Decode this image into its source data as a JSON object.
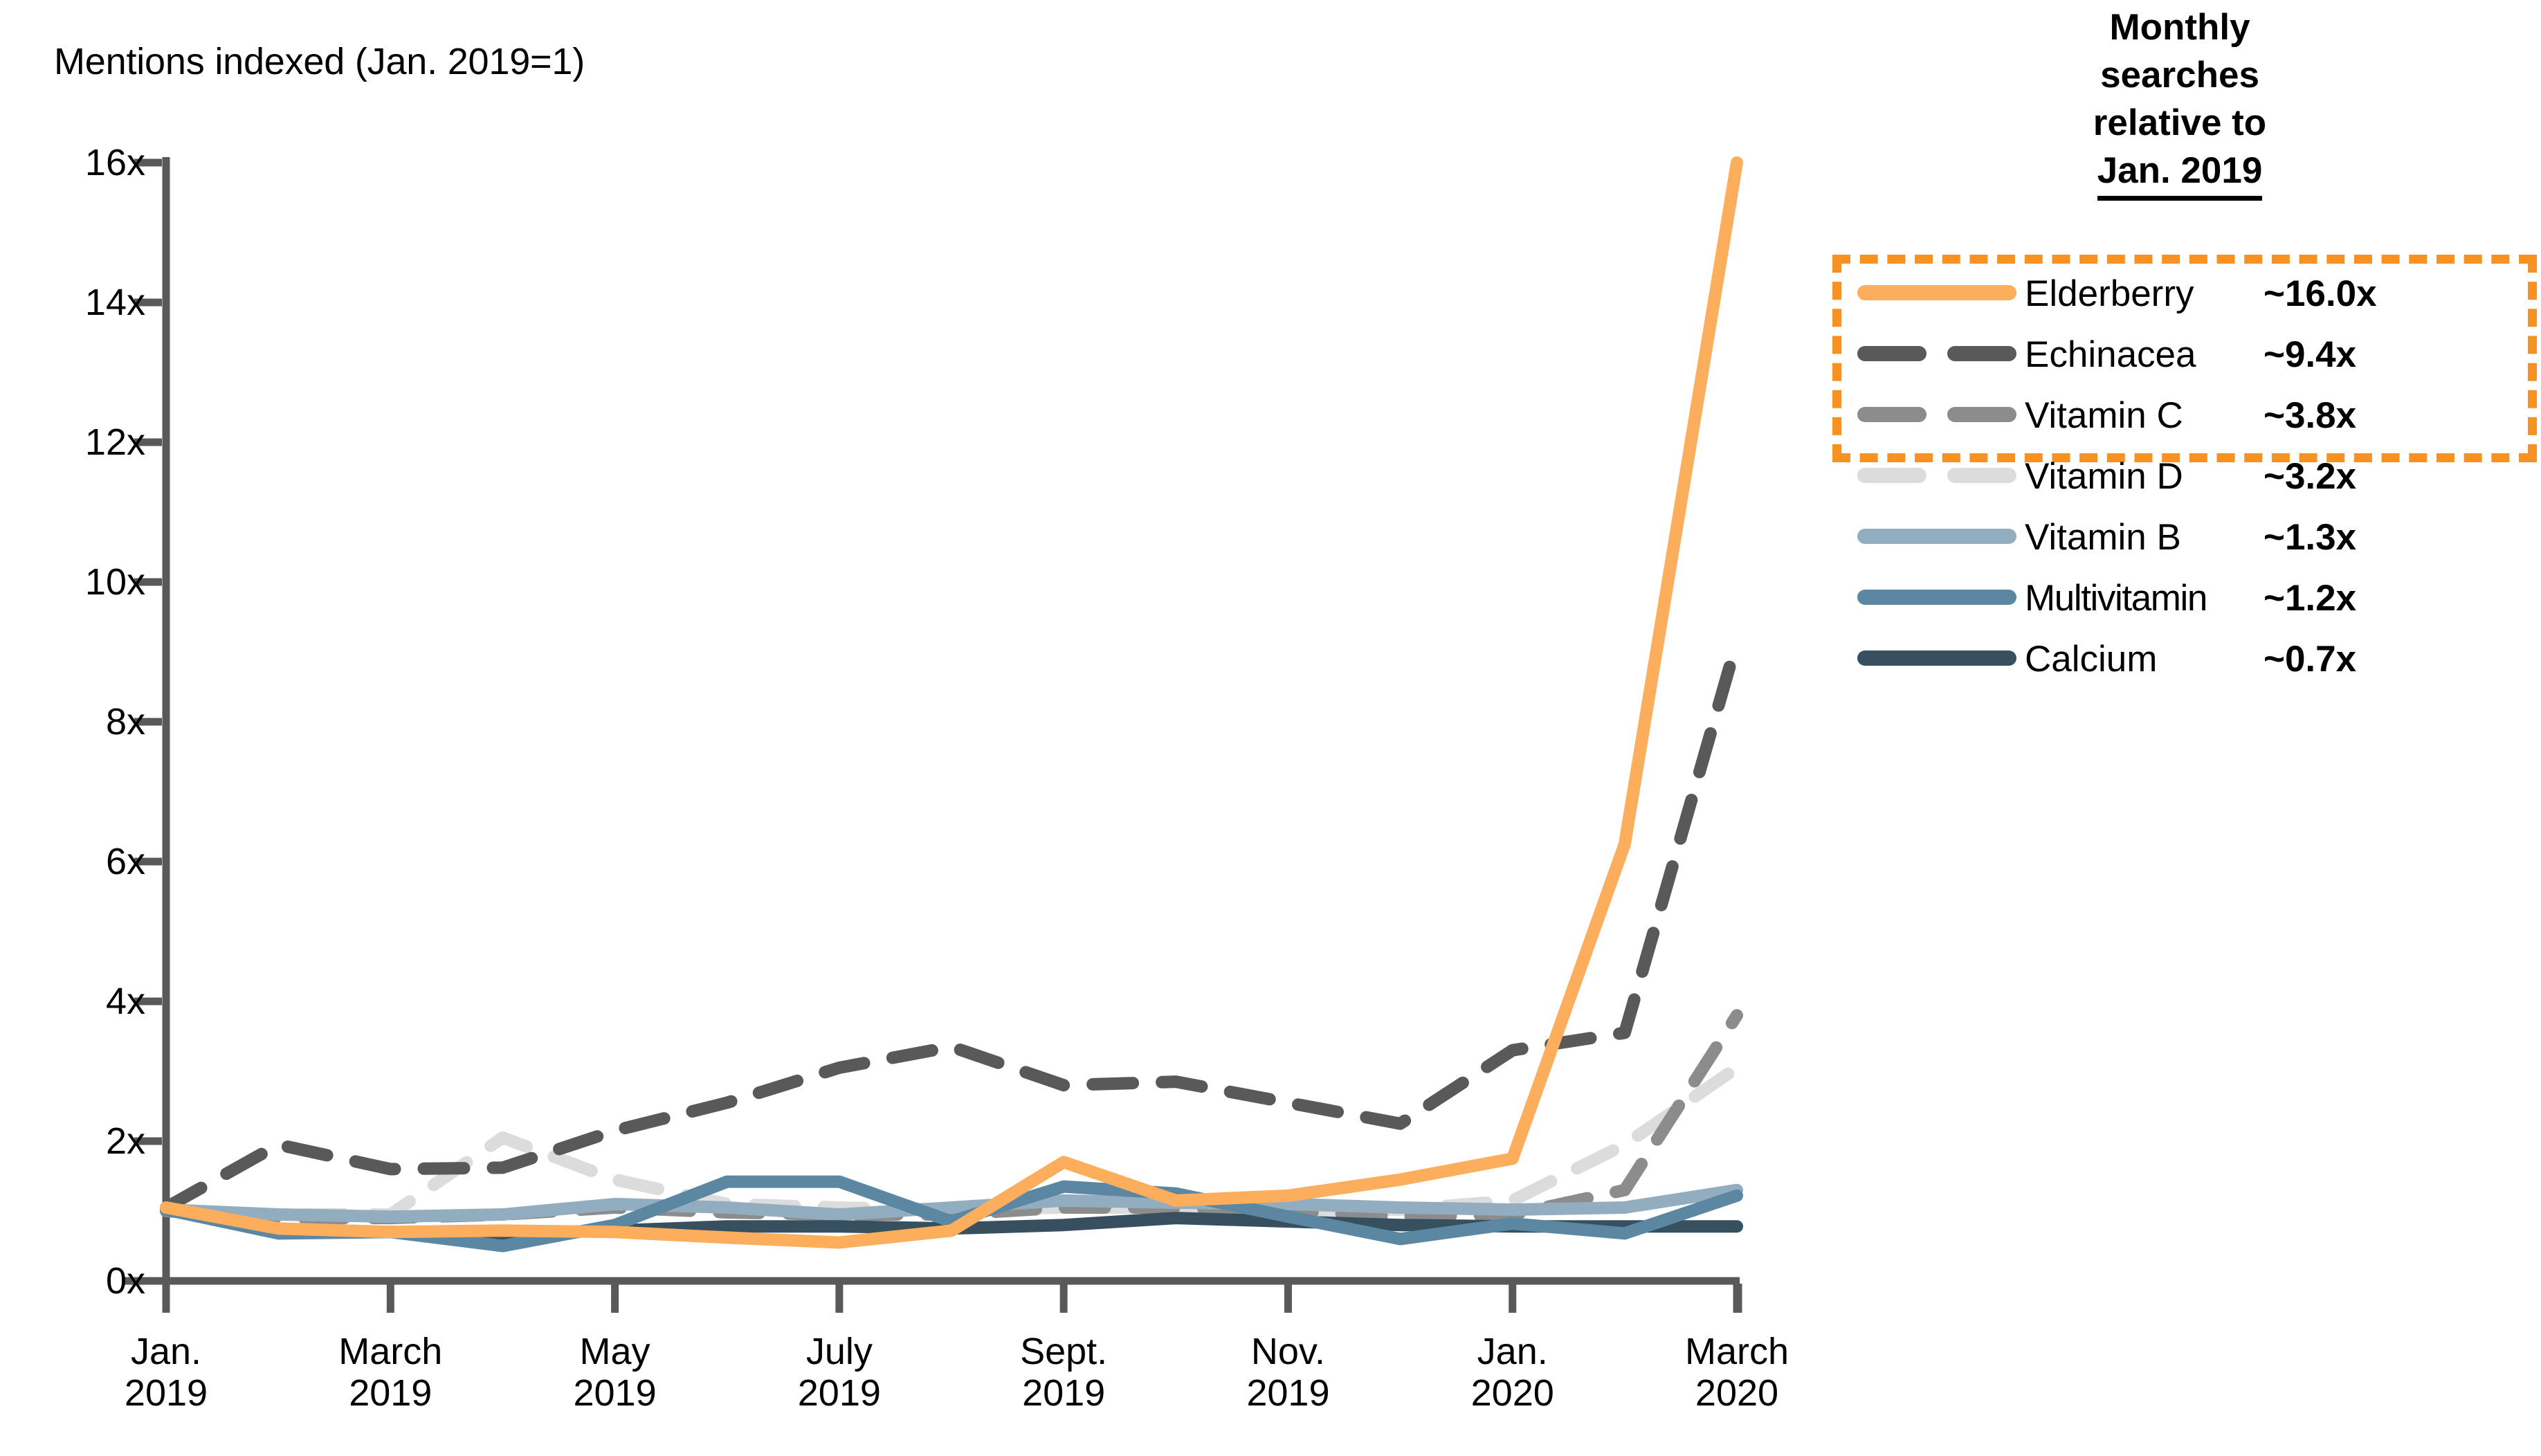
{
  "axis_title": "Mentions indexed (Jan. 2019=1)",
  "legend_header": {
    "line1": "Monthly",
    "line2": "searches",
    "line3": "relative to",
    "line4": "Jan. 2019"
  },
  "legend": {
    "items": [
      {
        "label": "Elderberry",
        "value": "~16.0x",
        "color": "#FDAE5D",
        "style": "solid",
        "boxed": true
      },
      {
        "label": "Echinacea",
        "value": "~9.4x",
        "color": "#595959",
        "style": "dashed",
        "boxed": true
      },
      {
        "label": "Vitamin C",
        "value": "~3.8x",
        "color": "#8C8C8C",
        "style": "dashed",
        "boxed": true
      },
      {
        "label": "Vitamin D",
        "value": "~3.2x",
        "color": "#DCDCDC",
        "style": "dashed",
        "boxed": true
      },
      {
        "label": "Vitamin B",
        "value": "~1.3x",
        "color": "#93ADC0",
        "style": "solid",
        "boxed": false
      },
      {
        "label": "Multivitamin",
        "value": "~1.2x",
        "color": "#5B87A3",
        "style": "solid",
        "boxed": false
      },
      {
        "label": "Calcium",
        "value": "~0.7x",
        "color": "#37505F",
        "style": "solid",
        "boxed": false
      }
    ],
    "highlight_color": "#F79122"
  },
  "colors": {
    "axis": "#595959",
    "text": "#000000",
    "background": "#FFFFFF",
    "accent": "#F79122"
  },
  "chart_data": {
    "type": "line",
    "title": "Mentions indexed (Jan. 2019=1)",
    "xlabel": "",
    "ylabel": "Mentions indexed (Jan. 2019=1)",
    "ylim": [
      0,
      16
    ],
    "yticks": [
      0,
      2,
      4,
      6,
      8,
      10,
      12,
      14,
      16
    ],
    "ytick_labels": [
      "0x",
      "2x",
      "4x",
      "6x",
      "8x",
      "10x",
      "12x",
      "14x",
      "16x"
    ],
    "grid": false,
    "legend_position": "right",
    "x": [
      "Jan. 2019",
      "Feb. 2019",
      "March 2019",
      "April 2019",
      "May 2019",
      "June 2019",
      "July 2019",
      "Aug. 2019",
      "Sept. 2019",
      "Oct. 2019",
      "Nov. 2019",
      "Dec. 2019",
      "Jan. 2020",
      "Feb. 2020",
      "March 2020"
    ],
    "xtick_labels": [
      {
        "month": "Jan.",
        "year": "2019"
      },
      {
        "month": "March",
        "year": "2019"
      },
      {
        "month": "May",
        "year": "2019"
      },
      {
        "month": "July",
        "year": "2019"
      },
      {
        "month": "Sept.",
        "year": "2019"
      },
      {
        "month": "Nov.",
        "year": "2019"
      },
      {
        "month": "Jan.",
        "year": "2020"
      },
      {
        "month": "March",
        "year": "2020"
      }
    ],
    "xtick_indices": [
      0,
      2,
      4,
      6,
      8,
      10,
      12,
      14
    ],
    "series": [
      {
        "name": "Elderberry",
        "color": "#FDAE5D",
        "style": "solid",
        "final_value": "~16.0x",
        "values": [
          1.05,
          0.75,
          0.7,
          0.72,
          0.7,
          0.62,
          0.55,
          0.72,
          1.7,
          1.15,
          1.22,
          1.45,
          1.75,
          6.25,
          16.0
        ]
      },
      {
        "name": "Echinacea",
        "color": "#595959",
        "style": "dashed",
        "final_value": "~9.4x",
        "values": [
          1.05,
          1.95,
          1.6,
          1.62,
          2.15,
          2.55,
          3.05,
          3.35,
          2.8,
          2.85,
          2.55,
          2.25,
          3.3,
          3.55,
          9.15
        ]
      },
      {
        "name": "Vitamin C",
        "color": "#8C8C8C",
        "style": "dashed",
        "final_value": "~3.8x",
        "values": [
          1.0,
          0.9,
          0.9,
          0.95,
          1.05,
          0.98,
          0.95,
          0.95,
          1.05,
          1.05,
          1.0,
          0.92,
          0.95,
          1.3,
          3.8
        ]
      },
      {
        "name": "Vitamin D",
        "color": "#DCDCDC",
        "style": "dashed",
        "final_value": "~3.2x",
        "values": [
          1.02,
          0.95,
          0.95,
          2.05,
          1.45,
          1.1,
          1.05,
          1.02,
          1.05,
          1.05,
          1.0,
          1.02,
          1.15,
          1.95,
          3.05
        ]
      },
      {
        "name": "Vitamin B",
        "color": "#93ADC0",
        "style": "solid",
        "final_value": "~1.3x",
        "values": [
          1.02,
          0.95,
          0.92,
          0.95,
          1.1,
          1.05,
          0.95,
          1.05,
          1.15,
          1.12,
          1.1,
          1.05,
          1.02,
          1.05,
          1.3
        ]
      },
      {
        "name": "Multivitamin",
        "color": "#5B87A3",
        "style": "solid",
        "final_value": "~1.2x",
        "values": [
          1.02,
          0.68,
          0.7,
          0.5,
          0.8,
          1.42,
          1.42,
          0.85,
          1.35,
          1.25,
          0.92,
          0.6,
          0.82,
          0.68,
          1.22
        ]
      },
      {
        "name": "Calcium",
        "color": "#37505F",
        "style": "solid",
        "final_value": "~0.7x",
        "values": [
          1.02,
          0.72,
          0.7,
          0.68,
          0.72,
          0.78,
          0.78,
          0.75,
          0.8,
          0.9,
          0.85,
          0.8,
          0.78,
          0.78,
          0.78
        ]
      }
    ]
  }
}
